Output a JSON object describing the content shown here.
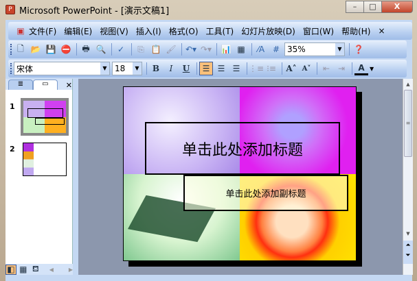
{
  "window": {
    "title": "Microsoft PowerPoint - [演示文稿1]",
    "minimize": "–",
    "maximize": "□",
    "close": "X"
  },
  "menu": {
    "items": [
      "文件(F)",
      "编辑(E)",
      "视图(V)",
      "插入(I)",
      "格式(O)",
      "工具(T)",
      "幻灯片放映(D)",
      "窗口(W)",
      "帮助(H)"
    ],
    "close": "×"
  },
  "standard_toolbar": {
    "zoom": "35%"
  },
  "format_toolbar": {
    "font": "宋体",
    "size": "18",
    "bold": "B",
    "italic": "I",
    "underline": "U",
    "font_color": "A"
  },
  "pane": {
    "slide_numbers": [
      "1",
      "2"
    ]
  },
  "slide": {
    "title_placeholder": "单击此处添加标题",
    "subtitle_placeholder": "单击此处添加副标题"
  }
}
